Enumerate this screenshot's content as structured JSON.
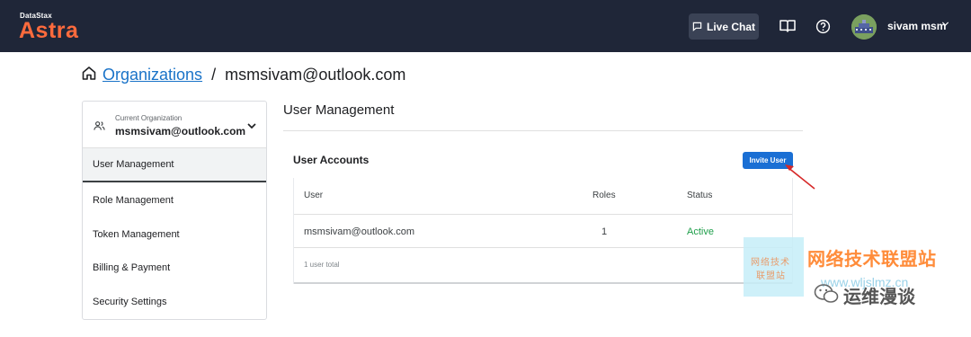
{
  "header": {
    "brand_small": "DataStax",
    "brand": "Astra",
    "live_chat_label": "Live Chat",
    "docs_icon": "book-icon",
    "help_icon": "help-circle-icon",
    "user_name": "sivam msm",
    "colors": {
      "topbar": "#1f2638",
      "brand": "#ff6b3d"
    }
  },
  "breadcrumb": {
    "home_icon": "home-icon",
    "link": "Organizations",
    "separator": "/",
    "current": "msmsivam@outlook.com"
  },
  "sidebar": {
    "org_label": "Current Organization",
    "org_value": "msmsivam@outlook.com",
    "items": [
      {
        "label": "User Management",
        "active": true
      },
      {
        "label": "Role Management"
      },
      {
        "label": "Token Management"
      },
      {
        "label": "Billing & Payment"
      },
      {
        "label": "Security Settings"
      }
    ]
  },
  "main": {
    "title": "User Management",
    "card_title": "User Accounts",
    "invite_label": "Invite User",
    "columns": [
      "User",
      "Roles",
      "Status"
    ],
    "rows": [
      {
        "user": "msmsivam@outlook.com",
        "roles": "1",
        "status": "Active"
      }
    ],
    "total": "1 user total",
    "colors": {
      "invite": "#1a6fd4",
      "status_active": "#1e9e4a"
    }
  },
  "watermark": {
    "box_line1": "网络技术",
    "box_line2": "联盟站",
    "title": "网络技术联盟站",
    "url": "www.wljslmz.cn",
    "sub": "运维漫谈"
  }
}
